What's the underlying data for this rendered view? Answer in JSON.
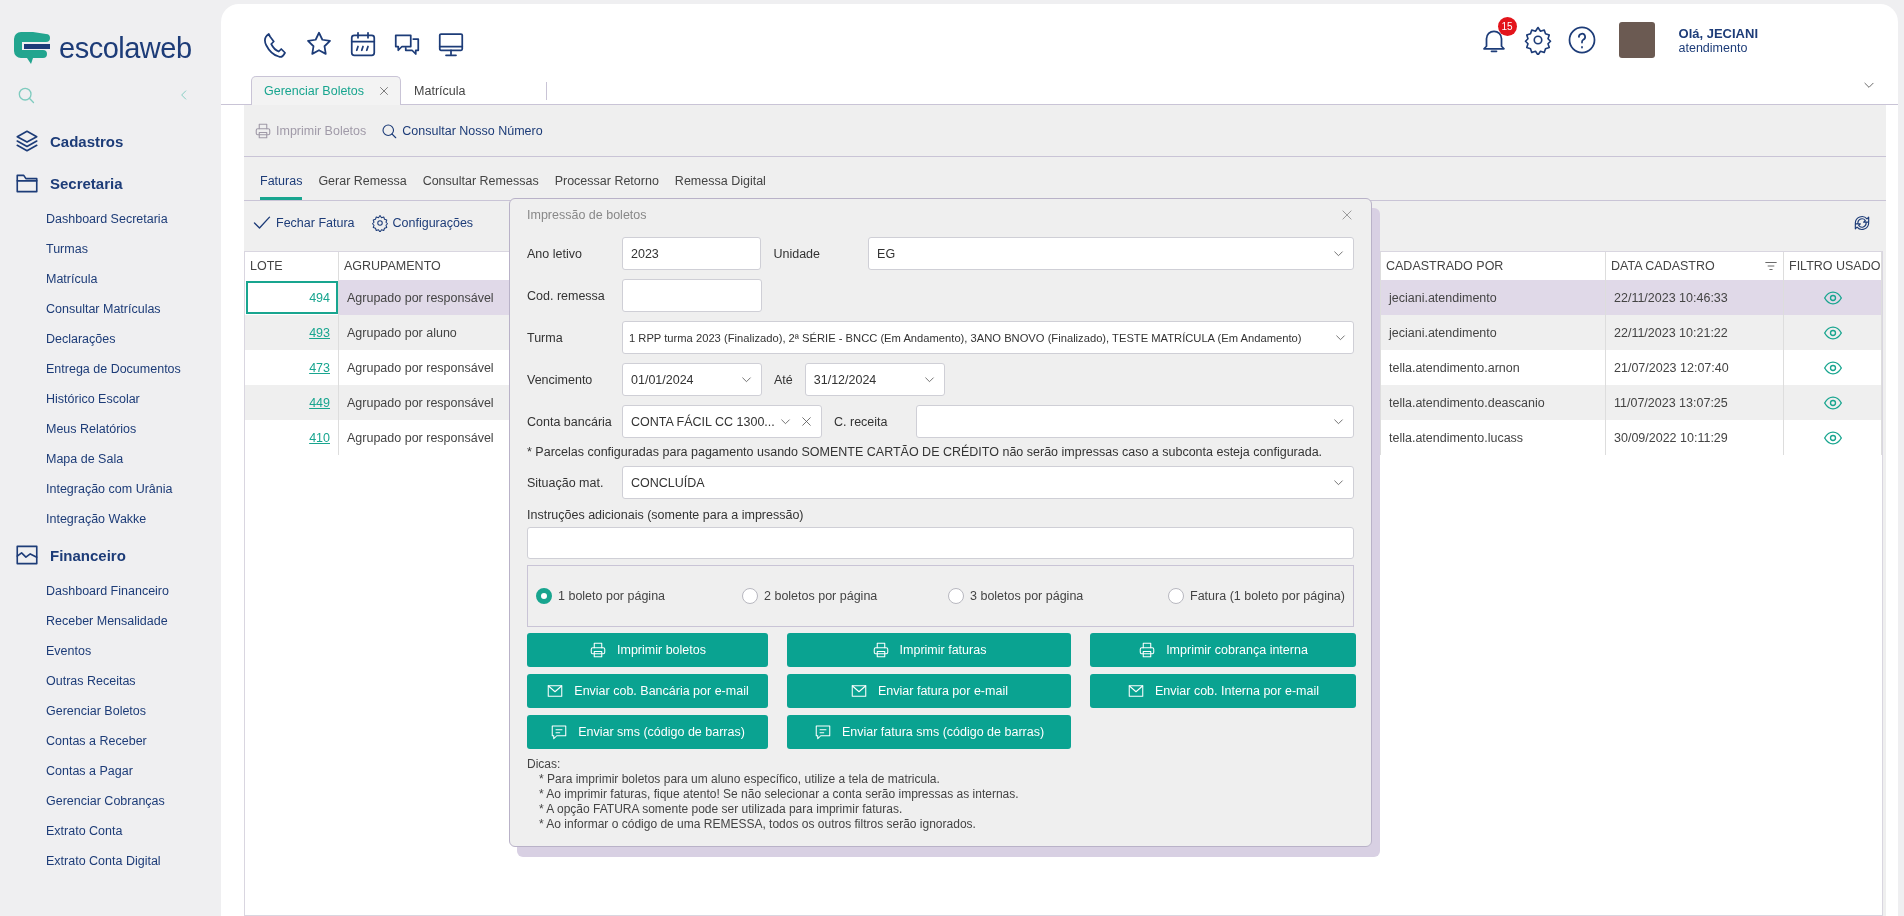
{
  "sidebar": {
    "logo": "escolaweb",
    "sections": [
      {
        "label": "Cadastros"
      },
      {
        "label": "Secretaria",
        "items": [
          "Dashboard Secretaria",
          "Turmas",
          "Matrícula",
          "Consultar Matrículas",
          "Declarações",
          "Entrega de Documentos",
          "Histórico Escolar",
          "Meus Relatórios",
          "Mapa de Sala",
          "Integração com Urânia",
          "Integração Wakke"
        ]
      },
      {
        "label": "Financeiro",
        "items": [
          "Dashboard Financeiro",
          "Receber Mensalidade",
          "Eventos",
          "Outras Receitas",
          "Gerenciar Boletos",
          "Contas a Receber",
          "Contas a Pagar",
          "Gerenciar Cobranças",
          "Extrato Conta",
          "Extrato Conta Digital"
        ]
      }
    ]
  },
  "header": {
    "notification_count": "15",
    "greeting": "Olá, JECIANI",
    "role": "atendimento"
  },
  "tabs": [
    {
      "label": "Gerenciar Boletos",
      "selected": true
    },
    {
      "label": "Matrícula",
      "selected": false
    }
  ],
  "toolbar": [
    {
      "label": "Imprimir Boletos",
      "disabled": true
    },
    {
      "label": "Consultar Nosso Número",
      "disabled": false
    }
  ],
  "subtabs": [
    {
      "label": "Faturas",
      "selected": true
    },
    {
      "label": "Gerar Remessa",
      "selected": false
    },
    {
      "label": "Consultar Remessas",
      "selected": false
    },
    {
      "label": "Processar Retorno",
      "selected": false
    },
    {
      "label": "Remessa Digital",
      "selected": false
    }
  ],
  "actions": [
    "Fechar Fatura",
    "Configurações"
  ],
  "table": {
    "columns": [
      "LOTE",
      "AGRUPAMENTO",
      "CADASTRADO POR",
      "DATA CADASTRO",
      "FILTRO USADO"
    ],
    "rows": [
      {
        "lote": "494",
        "agrupamento": "Agrupado por responsável",
        "cadastrado_por": "jeciani.atendimento",
        "data_cadastro": "22/11/2023 10:46:33",
        "selected": true
      },
      {
        "lote": "493",
        "agrupamento": "Agrupado por aluno",
        "cadastrado_por": "jeciani.atendimento",
        "data_cadastro": "22/11/2023 10:21:22",
        "selected": false
      },
      {
        "lote": "473",
        "agrupamento": "Agrupado por responsável",
        "cadastrado_por": "tella.atendimento.arnon",
        "data_cadastro": "21/07/2023 12:07:40",
        "selected": false
      },
      {
        "lote": "449",
        "agrupamento": "Agrupado por responsável",
        "cadastrado_por": "tella.atendimento.deascanio",
        "data_cadastro": "11/07/2023 13:07:25",
        "selected": false
      },
      {
        "lote": "410",
        "agrupamento": "Agrupado por responsável",
        "cadastrado_por": "tella.atendimento.lucass",
        "data_cadastro": "30/09/2022 10:11:29",
        "selected": false
      }
    ]
  },
  "modal": {
    "title": "Impressão de boletos",
    "ano_letivo": {
      "label": "Ano letivo",
      "value": "2023"
    },
    "unidade": {
      "label": "Unidade",
      "value": "EG"
    },
    "cod_remessa": {
      "label": "Cod. remessa"
    },
    "turma": {
      "label": "Turma",
      "value": "1 RPP turma 2023 (Finalizado), 2ª SÉRIE - BNCC (Em Andamento), 3ANO BNOVO (Finalizado), TESTE MATRÍCULA (Em Andamento)"
    },
    "vencimento": {
      "label": "Vencimento",
      "value": "01/01/2024"
    },
    "ate": {
      "label": "Até",
      "value": "31/12/2024"
    },
    "conta_bancaria": {
      "label": "Conta bancária",
      "value": "CONTA FÁCIL CC 1300..."
    },
    "c_receita": {
      "label": "C. receita"
    },
    "note": "* Parcelas configuradas para pagamento usando SOMENTE CARTÃO DE CRÉDITO não serão impressas caso a subconta esteja configurada.",
    "situacao": {
      "label": "Situação mat.",
      "value": "CONCLUÍDA"
    },
    "instrucoes": {
      "label": "Instruções adicionais (somente para a impressão)"
    },
    "layout_options": [
      {
        "label": "1 boleto por página",
        "selected": true
      },
      {
        "label": "2 boletos por página",
        "selected": false
      },
      {
        "label": "3 boletos por página",
        "selected": false
      },
      {
        "label": "Fatura (1 boleto por página)",
        "selected": false
      }
    ],
    "buttons": [
      "Imprimir boletos",
      "Imprimir faturas",
      "Imprimir cobrança interna",
      "Enviar cob. Bancária por e-mail",
      "Enviar fatura por e-mail",
      "Enviar cob. Interna por e-mail",
      "Enviar sms (código de barras)",
      "Enviar fatura sms (código de barras)"
    ],
    "tips_title": "Dicas:",
    "tips": [
      "* Para imprimir boletos para um aluno específico, utilize a tela de matricula.",
      "* Ao imprimir faturas, fique atento! Se não selecionar a conta serão impressas as internas.",
      "* A opção FATURA somente pode ser utilizada para imprimir faturas.",
      "* Ao informar o código de uma REMESSA, todos os outros filtros serão ignorados."
    ]
  }
}
